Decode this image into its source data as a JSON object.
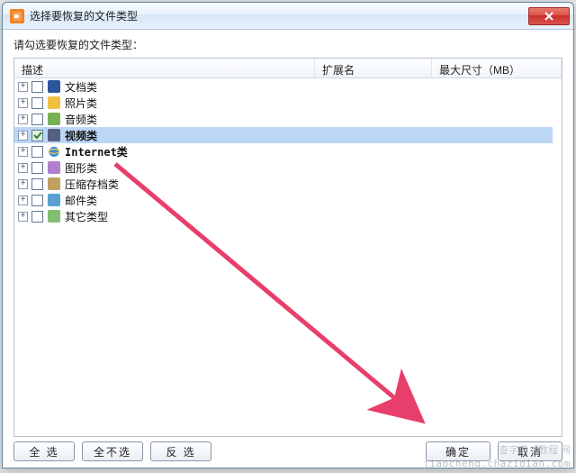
{
  "window": {
    "title": "选择要恢复的文件类型",
    "close_label": "X"
  },
  "instruction": "请勾选要恢复的文件类型：",
  "columns": {
    "desc": "描述",
    "ext": "扩展名",
    "size": "最大尺寸（MB）"
  },
  "rows": [
    {
      "id": "docs",
      "label": "文档类",
      "icon": "doc",
      "checked": false,
      "bold": false,
      "selected": false
    },
    {
      "id": "photos",
      "label": "照片类",
      "icon": "photo",
      "checked": false,
      "bold": false,
      "selected": false
    },
    {
      "id": "audio",
      "label": "音频类",
      "icon": "audio",
      "checked": false,
      "bold": false,
      "selected": false
    },
    {
      "id": "video",
      "label": "视频类",
      "icon": "video",
      "checked": true,
      "bold": true,
      "selected": true
    },
    {
      "id": "internet",
      "label": "Internet类",
      "icon": "ie",
      "checked": false,
      "bold": true,
      "selected": false
    },
    {
      "id": "graphics",
      "label": "图形类",
      "icon": "gfx",
      "checked": false,
      "bold": false,
      "selected": false
    },
    {
      "id": "archive",
      "label": "压缩存档类",
      "icon": "zip",
      "checked": false,
      "bold": false,
      "selected": false
    },
    {
      "id": "mail",
      "label": "邮件类",
      "icon": "mail",
      "checked": false,
      "bold": false,
      "selected": false
    },
    {
      "id": "other",
      "label": "其它类型",
      "icon": "other",
      "checked": false,
      "bold": false,
      "selected": false
    }
  ],
  "buttons": {
    "select_all": "全 选",
    "select_none": "全不选",
    "invert": "反 选",
    "ok": "确定",
    "cancel": "取消"
  },
  "watermark": {
    "line1": "查字典【教程 网",
    "line2": "jiaocheng.chazidian.com"
  },
  "colors": {
    "selection": "#bcd7f5",
    "arrow": "#e83e6b"
  }
}
